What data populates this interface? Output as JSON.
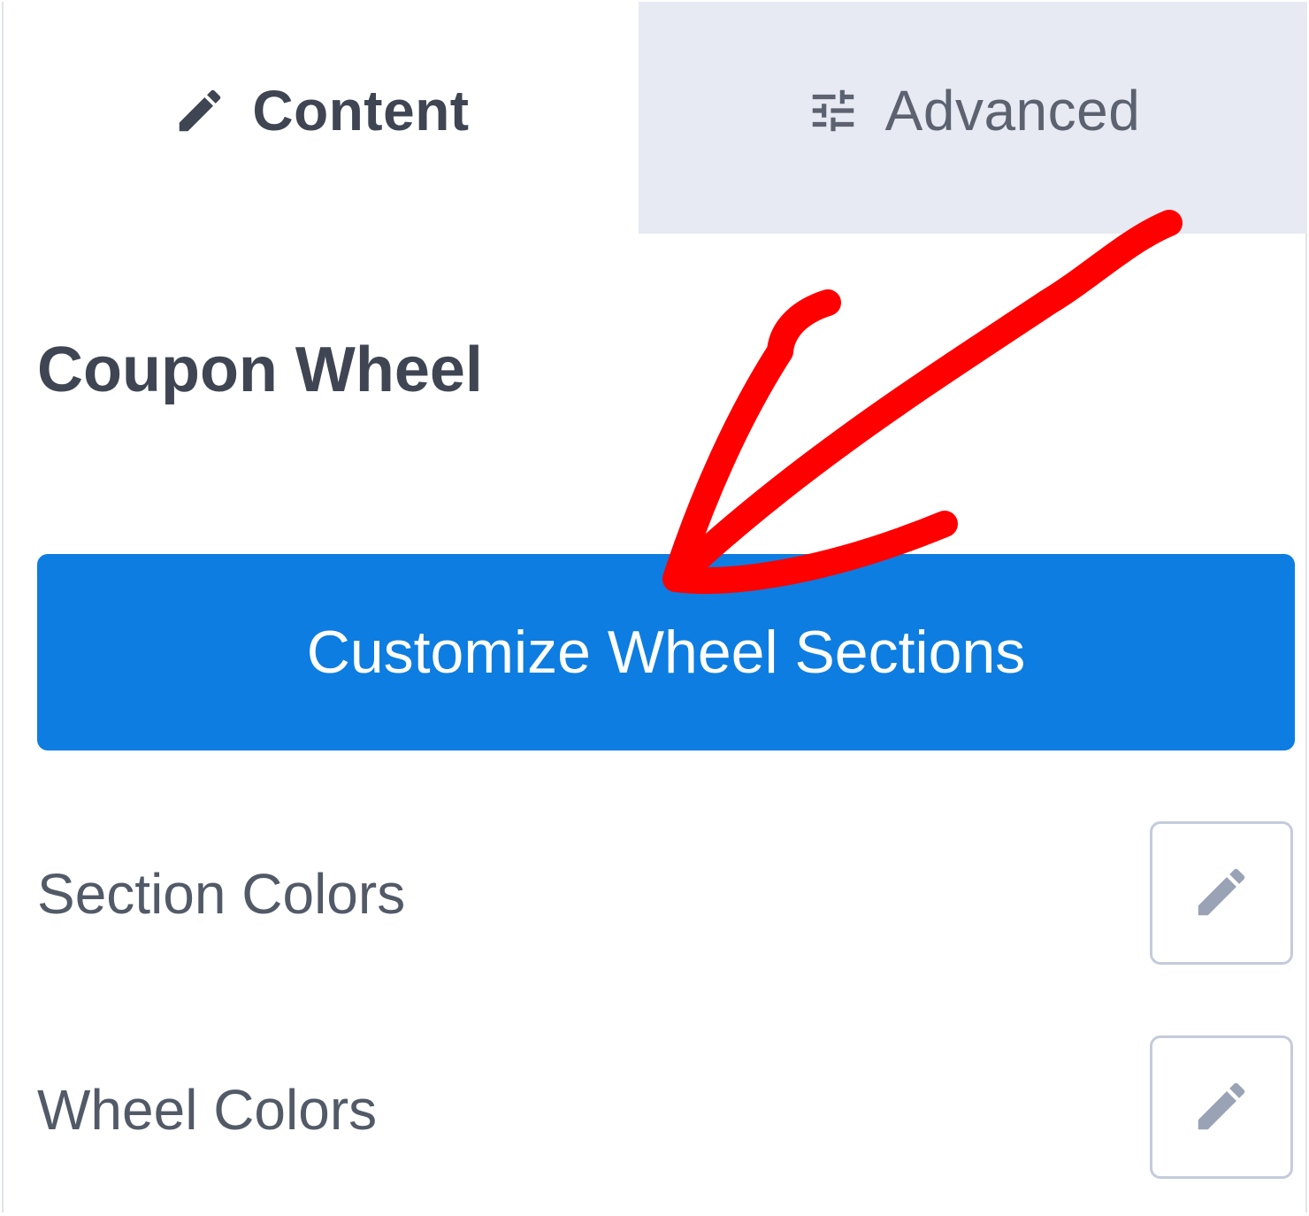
{
  "tabs": [
    {
      "label": "Content",
      "icon": "pencil-icon",
      "active": true
    },
    {
      "label": "Advanced",
      "icon": "sliders-icon",
      "active": false
    }
  ],
  "panel": {
    "title": "Coupon Wheel",
    "primary_button": "Customize Wheel Sections",
    "settings": [
      {
        "label": "Section Colors",
        "icon": "pencil-icon"
      },
      {
        "label": "Wheel Colors",
        "icon": "pencil-icon"
      }
    ]
  },
  "colors": {
    "primary_button": "#0d7de1",
    "inactive_tab": "#e7eaf2",
    "annotation": "#ff0000"
  }
}
